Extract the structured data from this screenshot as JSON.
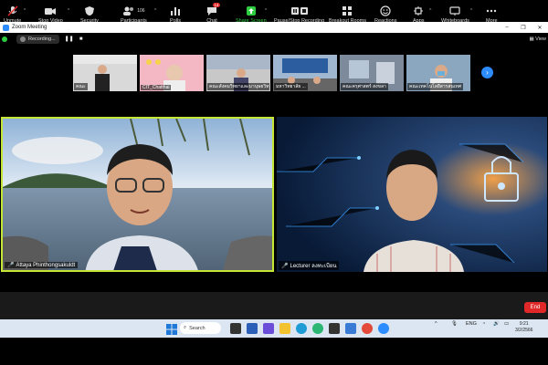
{
  "window": {
    "title": "Zoom Meeting",
    "min": "–",
    "max": "❐",
    "close": "✕"
  },
  "recording": {
    "label": "Recording...",
    "pause": "❚❚",
    "stop": "■"
  },
  "view_label": "▦ View",
  "strip": {
    "tiles": [
      {
        "name": "คณะ"
      },
      {
        "name": "CIT_Chatthai"
      },
      {
        "name": "คณะสังคมวิทยาและมานุษยวิทยา"
      },
      {
        "name": "มหาวิทยาลัย ..."
      },
      {
        "name": "คณะครุศาสตร์ สงขลา"
      },
      {
        "name": "คณะเทคโนโลยีสารสนเทศ"
      }
    ],
    "next": "›"
  },
  "videos": [
    {
      "name": "Attaya Phinthongsakuldt"
    },
    {
      "name": "Lecturer ลงทะเบียน"
    }
  ],
  "toolbar": {
    "items": [
      {
        "label": "Unmute",
        "icon": "🎤"
      },
      {
        "label": "Stop Video",
        "icon": "📹"
      },
      {
        "label": "Security",
        "icon": "🛡"
      },
      {
        "label": "Participants",
        "icon": "👥",
        "count": "106"
      },
      {
        "label": "Polls",
        "icon": "📊"
      },
      {
        "label": "Chat",
        "icon": "💬",
        "badge": "14"
      },
      {
        "label": "Share Screen",
        "icon": "⬆"
      },
      {
        "label": "Pause/Stop Recording",
        "icon": "⏸"
      },
      {
        "label": "Breakout Rooms",
        "icon": "⊞"
      },
      {
        "label": "Reactions",
        "icon": "☺"
      },
      {
        "label": "Apps",
        "icon": "⚙"
      },
      {
        "label": "Whiteboards",
        "icon": "▭"
      },
      {
        "label": "More",
        "icon": "•••"
      }
    ],
    "end": "End"
  },
  "taskbar": {
    "search": "Search",
    "lang": "ENG",
    "time": "9:21",
    "date": "3/2/2566"
  }
}
